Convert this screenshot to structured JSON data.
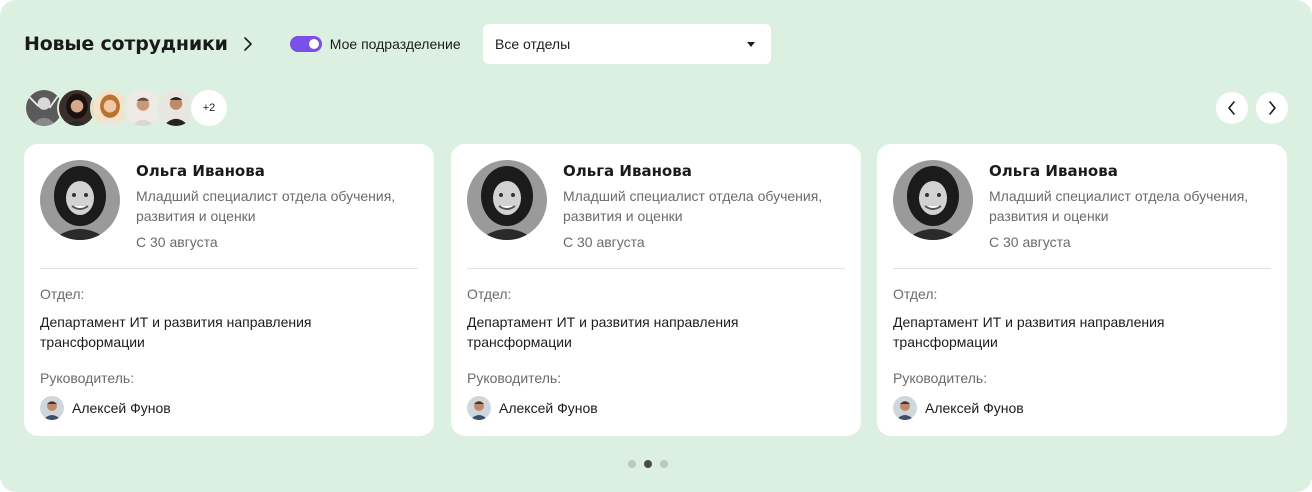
{
  "header": {
    "title": "Новые сотрудники",
    "toggle_label": "Мое подразделение",
    "toggle_on": true,
    "select_value": "Все отделы"
  },
  "avatar_stack": {
    "more_label": "+2"
  },
  "cards": [
    {
      "name": "Ольга Иванова",
      "position": "Младший специалист отдела обучения, развития и оценки",
      "date": "С 30 августа",
      "dept_label": "Отдел:",
      "dept": "Департамент ИТ и развития направления трансформации",
      "manager_label": "Руководитель:",
      "manager": "Алексей Фунов"
    },
    {
      "name": "Ольга Иванова",
      "position": "Младший специалист отдела обучения, развития и оценки",
      "date": "С 30 августа",
      "dept_label": "Отдел:",
      "dept": "Департамент ИТ и развития направления трансформации",
      "manager_label": "Руководитель:",
      "manager": "Алексей Фунов"
    },
    {
      "name": "Ольга Иванова",
      "position": "Младший специалист отдела обучения, развития и оценки",
      "date": "С 30 августа",
      "dept_label": "Отдел:",
      "dept": "Департамент ИТ и развития направления трансформации",
      "manager_label": "Руководитель:",
      "manager": "Алексей Фунов"
    }
  ],
  "pagination": {
    "active_page": 2,
    "total_pages": 3
  },
  "colors": {
    "background": "#dcf0e1",
    "accent": "#7b4fe9",
    "card": "#ffffff"
  }
}
